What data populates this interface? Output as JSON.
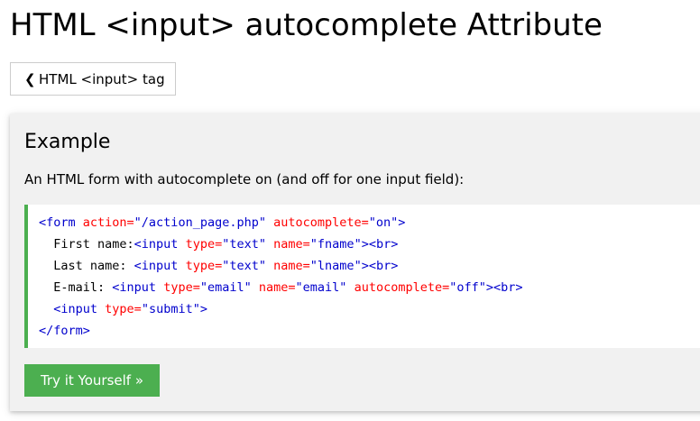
{
  "page": {
    "title": "HTML <input> autocomplete Attribute"
  },
  "back_button": {
    "chevron": "❮",
    "label": "HTML <input> tag"
  },
  "example": {
    "heading": "Example",
    "description": "An HTML form with autocomplete on (and off for one input field):",
    "code": {
      "line1": {
        "open": "<form",
        "a1": " action=",
        "v1": "\"/action_page.php\"",
        "a2": " autocomplete=",
        "v2": "\"on\"",
        "close": ">"
      },
      "line2": {
        "text": "  First name:",
        "open": "<input",
        "a1": " type=",
        "v1": "\"text\"",
        "a2": " name=",
        "v2": "\"fname\"",
        "close": "><br>"
      },
      "line3": {
        "text": "  Last name: ",
        "open": "<input",
        "a1": " type=",
        "v1": "\"text\"",
        "a2": " name=",
        "v2": "\"lname\"",
        "close": "><br>"
      },
      "line4": {
        "text": "  E-mail: ",
        "open": "<input",
        "a1": " type=",
        "v1": "\"email\"",
        "a2": " name=",
        "v2": "\"email\"",
        "a3": " autocomplete=",
        "v3": "\"off\"",
        "close": "><br>"
      },
      "line5": {
        "indent": "  ",
        "open": "<input",
        "a1": " type=",
        "v1": "\"submit\"",
        "close": ">"
      },
      "line6": {
        "close": "</form>"
      }
    },
    "try_button_label": "Try it Yourself »"
  },
  "colors": {
    "accent_green": "#4caf50",
    "tag_color": "#0000cd",
    "attribute_color": "#ff0000",
    "panel_background": "#f1f1f1"
  }
}
